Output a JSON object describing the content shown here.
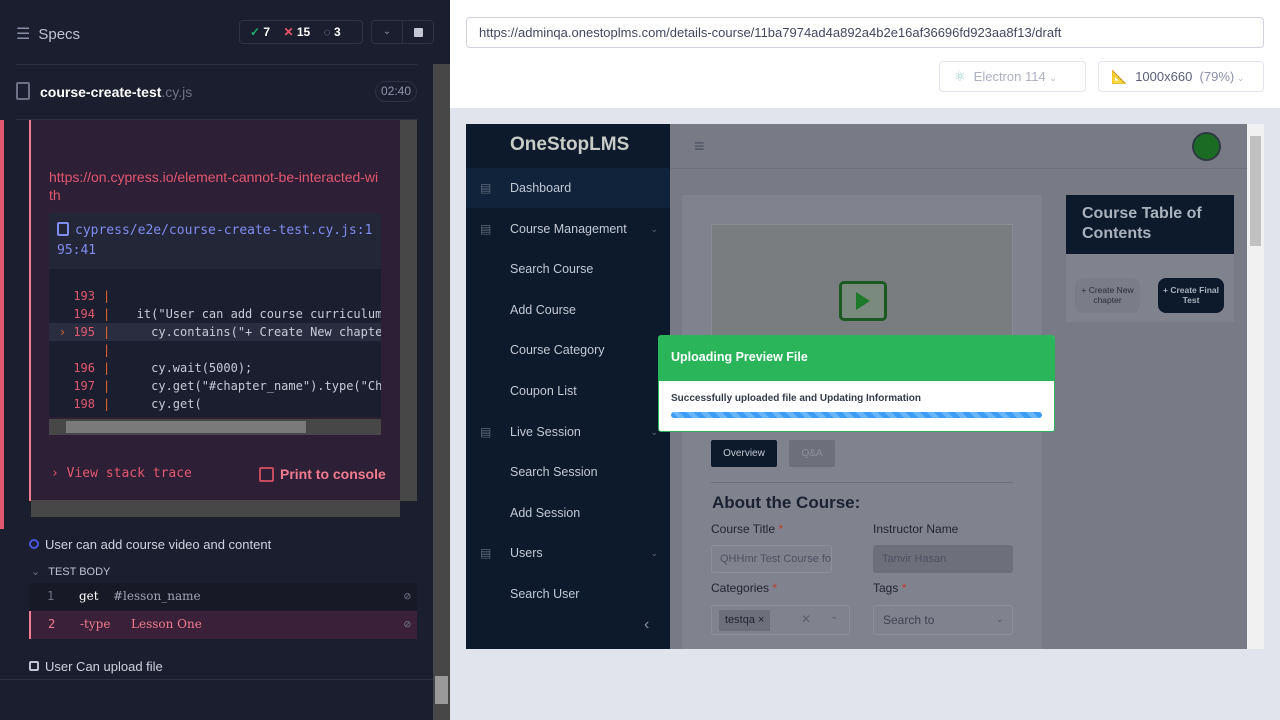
{
  "runner": {
    "specs_label": "Specs",
    "stats": {
      "passed": "7",
      "failed": "15",
      "pending": "3"
    },
    "spec_file": {
      "name": "course-create-test",
      "ext": ".cy.js",
      "duration": "02:40"
    },
    "error": {
      "link": "https://on.cypress.io/element-cannot-be-interacted-with",
      "file": "cypress/e2e/course-create-test.cy.js:195:41",
      "code": [
        {
          "num": "193",
          "text": ""
        },
        {
          "num": "194",
          "text": "  it(\"User can add course curriculum\","
        },
        {
          "num": "195",
          "text": "    cy.contains(\"+ Create New chapter",
          "active": true
        },
        {
          "num": "",
          "text": ""
        },
        {
          "num": "196",
          "text": "    cy.wait(5000);"
        },
        {
          "num": "197",
          "text": "    cy.get(\"#chapter_name\").type(\"Chap"
        },
        {
          "num": "198",
          "text": "    cy.get("
        }
      ],
      "view_stack": "View stack trace",
      "print_console": "Print to console"
    },
    "tests": [
      {
        "title": "User can add course video and content",
        "state": "running"
      },
      {
        "title": "User Can upload file",
        "state": "pending"
      }
    ],
    "test_body_label": "TEST BODY",
    "commands": [
      {
        "num": "1",
        "name": "get",
        "arg": "#lesson_name"
      },
      {
        "num": "2",
        "name": "-type",
        "arg": "Lesson One"
      }
    ]
  },
  "browser": {
    "url": "https://adminqa.onestoplms.com/details-course/11ba7974ad4a892a4b2e16af36696fd923aa8f13/draft",
    "engine": "Electron 114",
    "viewport": "1000x660",
    "scale": "(79%)"
  },
  "app": {
    "logo": "OneStopLMS",
    "sidebar": [
      {
        "label": "Dashboard",
        "icon": "dashboard-icon"
      },
      {
        "label": "Course Management",
        "icon": "list-icon",
        "chevron": true
      },
      {
        "label": "Search Course"
      },
      {
        "label": "Add Course"
      },
      {
        "label": "Course Category"
      },
      {
        "label": "Coupon List"
      },
      {
        "label": "Live Session",
        "icon": "table-icon",
        "chevron": true
      },
      {
        "label": "Search Session"
      },
      {
        "label": "Add Session"
      },
      {
        "label": "Users",
        "icon": "user-icon",
        "chevron": true
      },
      {
        "label": "Search User"
      }
    ],
    "toc": {
      "title": "Course Table of Contents",
      "create_chapter": "+ Create New chapter",
      "create_test": "+ Create Final Test"
    },
    "tabs": {
      "overview": "Overview",
      "qa": "Q&A"
    },
    "about_title": "About the Course:",
    "form": {
      "course_title_label": "Course Title",
      "course_title_value": "QHHmr Test Course for a",
      "instructor_label": "Instructor Name",
      "instructor_value": "Tanvir Hasan",
      "categories_label": "Categories",
      "category_tag": "testqa",
      "tags_label": "Tags",
      "tags_placeholder": "Search to",
      "required_mark": "*"
    },
    "modal": {
      "title": "Uploading Preview File",
      "message": "Successfully uploaded file and Updating Information",
      "progress": 100
    }
  }
}
